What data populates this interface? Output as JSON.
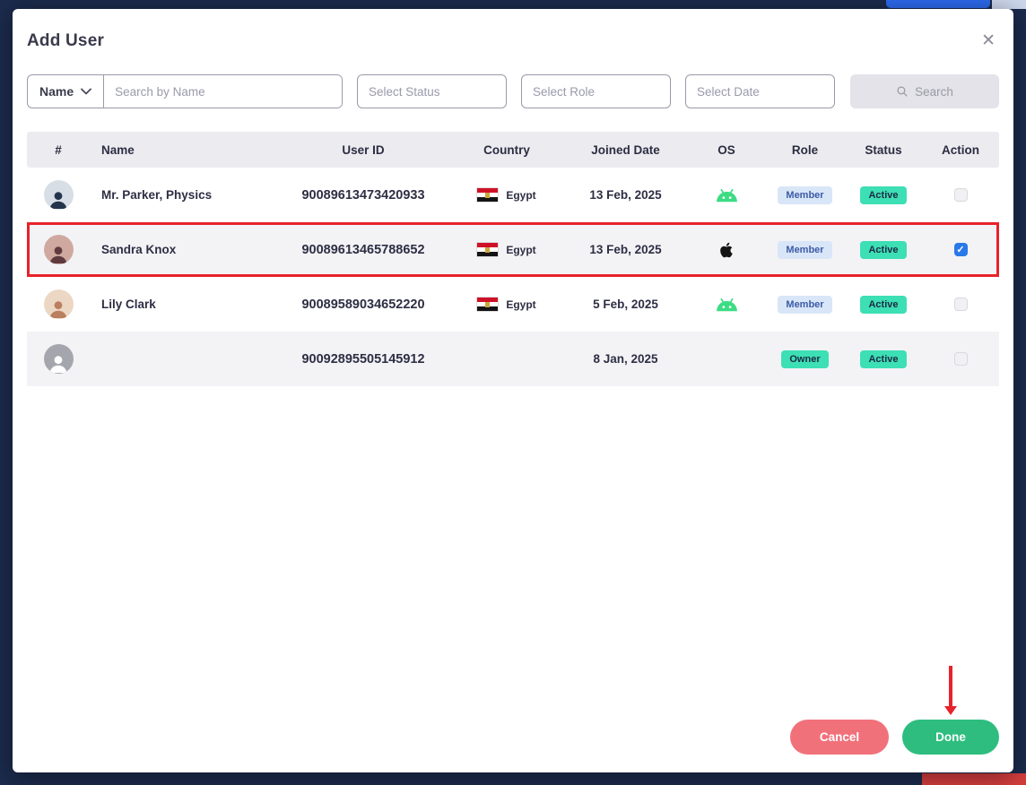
{
  "modal": {
    "title": "Add User",
    "close_glyph": "✕"
  },
  "filters": {
    "name_dropdown_label": "Name",
    "search_placeholder": "Search by Name",
    "status_placeholder": "Select Status",
    "role_placeholder": "Select Role",
    "date_placeholder": "Select Date",
    "search_button_label": "Search"
  },
  "table": {
    "headers": [
      "#",
      "Name",
      "User ID",
      "Country",
      "Joined Date",
      "OS",
      "Role",
      "Status",
      "Action"
    ],
    "rows": [
      {
        "name": "Mr. Parker, Physics",
        "user_id": "90089613473420933",
        "country": "Egypt",
        "joined_date": "13 Feb, 2025",
        "os": "android",
        "role": "Member",
        "status": "Active",
        "checked": false,
        "highlighted": false,
        "avatar": "man"
      },
      {
        "name": "Sandra Knox",
        "user_id": "90089613465788652",
        "country": "Egypt",
        "joined_date": "13 Feb, 2025",
        "os": "apple",
        "role": "Member",
        "status": "Active",
        "checked": true,
        "highlighted": true,
        "avatar": "woman"
      },
      {
        "name": "Lily Clark",
        "user_id": "90089589034652220",
        "country": "Egypt",
        "joined_date": "5 Feb, 2025",
        "os": "android",
        "role": "Member",
        "status": "Active",
        "checked": false,
        "highlighted": false,
        "avatar": "blonde"
      },
      {
        "name": "",
        "user_id": "90092895505145912",
        "country": "",
        "joined_date": "8 Jan, 2025",
        "os": "",
        "role": "Owner",
        "status": "Active",
        "checked": false,
        "highlighted": false,
        "avatar": "placeholder"
      }
    ]
  },
  "footer": {
    "cancel_label": "Cancel",
    "done_label": "Done"
  },
  "colors": {
    "checkbox_checked": "#2979e8",
    "highlight_border": "#e8222b",
    "active_badge": "#3ddfb4",
    "member_badge_bg": "#d9e6f8",
    "member_badge_text": "#3c5ba6",
    "cancel_button": "#f1717b",
    "done_button": "#2ebd7e",
    "android_green": "#3ddc84"
  }
}
